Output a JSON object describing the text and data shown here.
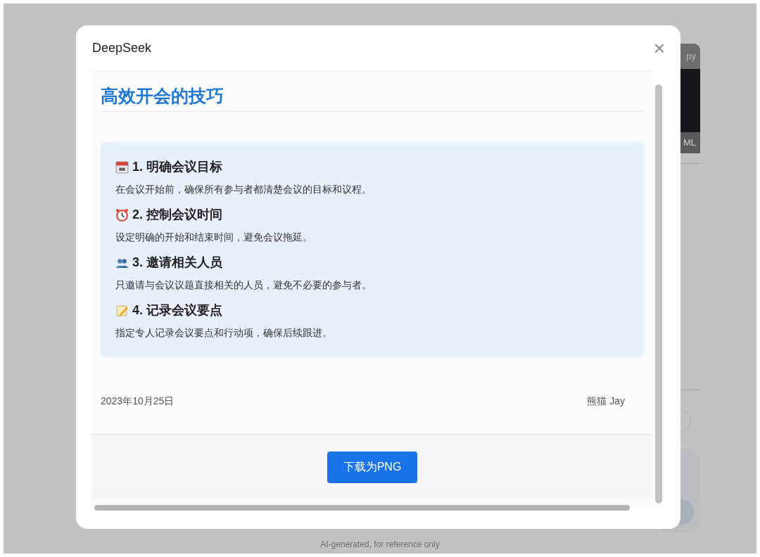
{
  "backdrop": {
    "panel_top_text": "py",
    "panel_bottom_text": "ML",
    "disclaimer": "AI-generated, for reference only"
  },
  "dialog": {
    "title": "DeepSeek",
    "close": "×",
    "page": {
      "title": "高效开会的技巧",
      "sections": [
        {
          "kind": "calendar",
          "heading": "1. 明确会议目标",
          "text": "在会议开始前，确保所有参与者都清楚会议的目标和议程。"
        },
        {
          "kind": "alarm",
          "heading": "2. 控制会议时间",
          "text": "设定明确的开始和结束时间，避免会议拖延。"
        },
        {
          "kind": "people",
          "heading": "3. 邀请相关人员",
          "text": "只邀请与会议议题直接相关的人员，避免不必要的参与者。"
        },
        {
          "kind": "memo",
          "heading": "4. 记录会议要点",
          "text": "指定专人记录会议要点和行动项，确保后续跟进。"
        }
      ],
      "date": "2023年10月25日",
      "author": "熊猫 Jay"
    },
    "download_button": "下载为PNG"
  }
}
